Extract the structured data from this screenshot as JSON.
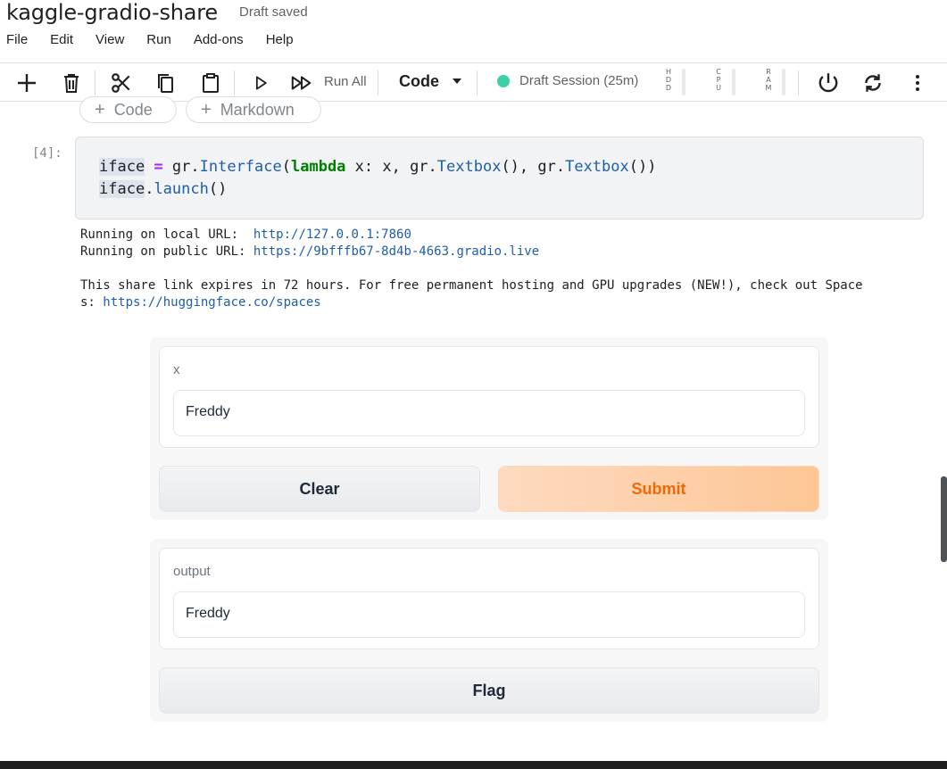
{
  "app": {
    "title": "kaggle-gradio-share",
    "save_status": "Draft saved"
  },
  "menu": [
    "File",
    "Edit",
    "View",
    "Run",
    "Add-ons",
    "Help"
  ],
  "toolbar": {
    "run_all_label": "Run All",
    "cell_type": "Code",
    "session_label": "Draft Session (25m)",
    "session_status_color": "#3ccfa8",
    "resources": [
      {
        "name": "HDD",
        "letters": "H\nD\nD"
      },
      {
        "name": "CPU",
        "letters": "C\nP\nU"
      },
      {
        "name": "RAM",
        "letters": "R\nA\nM"
      }
    ],
    "icons": [
      "plus-icon",
      "trash-icon",
      "scissors-icon",
      "copy-icon",
      "clipboard-icon",
      "play-icon",
      "fast-forward-icon",
      "power-icon",
      "refresh-icon",
      "more-vert-icon"
    ]
  },
  "add_cell": {
    "code_label": "Code",
    "markdown_label": "Markdown"
  },
  "cell": {
    "execution_count": "[4]:",
    "code": {
      "line1": {
        "var": "iface",
        "eq": " = ",
        "mod": "gr.",
        "fn": "Interface",
        "open": "(",
        "kw": "lambda",
        "rest1": " x: x, gr.",
        "fn2": "Textbox",
        "mid": "(), gr.",
        "fn3": "Textbox",
        "close": "())"
      },
      "line2": {
        "var": "iface",
        "dot": ".",
        "fn": "launch",
        "call": "()"
      }
    },
    "output": {
      "local_prefix": "Running on local URL:  ",
      "local_url": "http://127.0.0.1:7860",
      "public_prefix": "Running on public URL: ",
      "public_url": "https://9bfffb67-8d4b-4663.gradio.live",
      "share_note": "This share link expires in 72 hours. For free permanent hosting and GPU upgrades (NEW!), check out Space",
      "share_note_cont": "s: ",
      "spaces_url": "https://huggingface.co/spaces"
    }
  },
  "gradio": {
    "input_label": "x",
    "input_value": "Freddy",
    "clear_label": "Clear",
    "submit_label": "Submit",
    "output_label": "output",
    "output_value": "Freddy",
    "flag_label": "Flag",
    "accent_color": "#ea6a0a"
  }
}
